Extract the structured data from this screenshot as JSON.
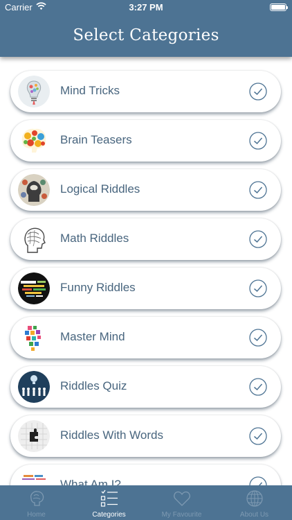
{
  "status": {
    "carrier": "Carrier",
    "time": "3:27 PM"
  },
  "header": {
    "title": "Select Categories"
  },
  "categories": [
    {
      "label": "Mind Tricks",
      "icon": "lightbulb-icon"
    },
    {
      "label": "Brain Teasers",
      "icon": "gear-brain-icon"
    },
    {
      "label": "Logical Riddles",
      "icon": "brain-head-icon"
    },
    {
      "label": "Math Riddles",
      "icon": "sketch-head-icon"
    },
    {
      "label": "Funny Riddles",
      "icon": "word-cloud-icon"
    },
    {
      "label": "Master Mind",
      "icon": "colorful-letters-icon"
    },
    {
      "label": "Riddles Quiz",
      "icon": "people-lightbulb-icon"
    },
    {
      "label": "Riddles With Words",
      "icon": "puzzle-head-icon"
    },
    {
      "label": "What Am I?",
      "icon": "word-art-icon"
    }
  ],
  "tabs": [
    {
      "label": "Home",
      "icon": "brain-icon",
      "active": false
    },
    {
      "label": "Categories",
      "icon": "checklist-icon",
      "active": true
    },
    {
      "label": "My Favourite",
      "icon": "heart-icon",
      "active": false
    },
    {
      "label": "About Us",
      "icon": "globe-icon",
      "active": false
    }
  ],
  "colors": {
    "header": "#4d7393",
    "label": "#48657e",
    "check": "#4d7393"
  }
}
